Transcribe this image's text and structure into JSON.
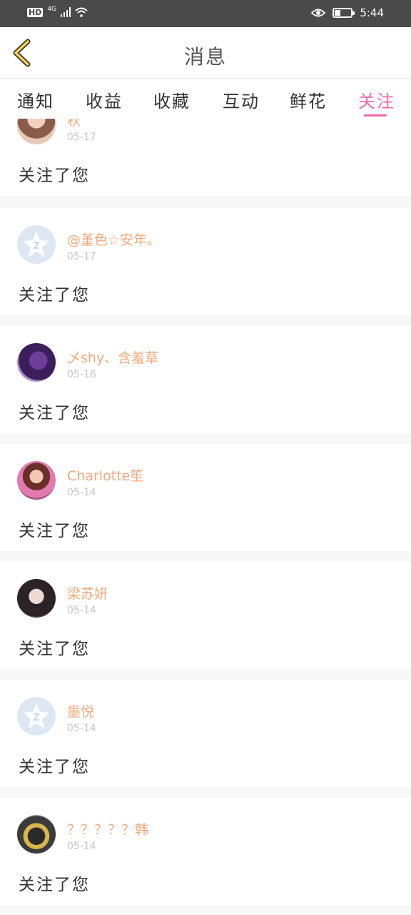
{
  "status_bar": {
    "network_badge": "HD",
    "network_type": "4G",
    "time": "5:44",
    "battery_level": 0.35,
    "icons": [
      "hd-icon",
      "signal-icon",
      "wifi-icon",
      "eye-icon",
      "battery-icon"
    ]
  },
  "header": {
    "title": "消息",
    "back_icon": "chevron-left-icon",
    "back_color": "#f4d34f"
  },
  "tabs": [
    {
      "label": "通知",
      "active": false
    },
    {
      "label": "收益",
      "active": false
    },
    {
      "label": "收藏",
      "active": false
    },
    {
      "label": "互动",
      "active": false
    },
    {
      "label": "鲜花",
      "active": false
    },
    {
      "label": "关注",
      "active": true
    }
  ],
  "colors": {
    "accent": "#f06aa7",
    "username": "#f2a97a",
    "date": "#c6c6c6",
    "divider": "#f7f7f7"
  },
  "items": [
    {
      "name": "秋",
      "date": "05-17",
      "text": "关注了您",
      "avatar": "photo-avatar"
    },
    {
      "name": "@堇色☆安年。",
      "date": "05-17",
      "text": "关注了您",
      "avatar": "default-avatar-icon"
    },
    {
      "name": "乄shy、含羞草",
      "date": "05-16",
      "text": "关注了您",
      "avatar": "photo-avatar"
    },
    {
      "name": "Charlotte笙",
      "date": "05-14",
      "text": "关注了您",
      "avatar": "photo-avatar"
    },
    {
      "name": "梁苏妍",
      "date": "05-14",
      "text": "关注了您",
      "avatar": "photo-avatar"
    },
    {
      "name": "墨悦",
      "date": "05-14",
      "text": "关注了您",
      "avatar": "default-avatar-icon"
    },
    {
      "name": "？？？？？韩",
      "date": "05-14",
      "text": "关注了您",
      "avatar": "photo-avatar"
    }
  ]
}
